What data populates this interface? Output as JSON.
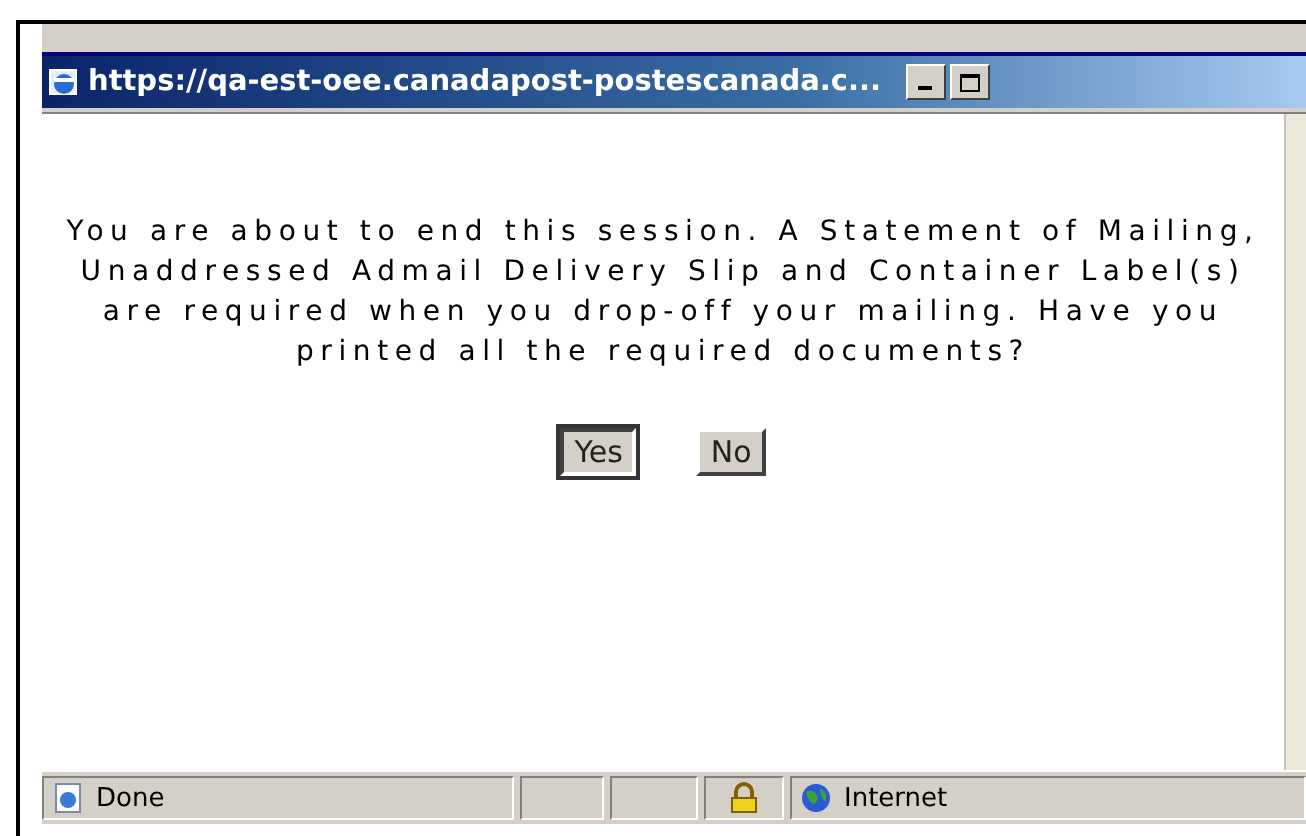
{
  "window": {
    "title": "https://qa-est-oee.canadapost-postescanada.c..."
  },
  "message": "You are about to end this session. A Statement of Mailing, Unaddressed Admail Delivery Slip and Container Label(s) are required when you drop-off your mailing. Have you printed all the required documents?",
  "buttons": [
    {
      "label": "Yes",
      "focused": true
    },
    {
      "label": "No",
      "focused": false
    }
  ],
  "status_bar": {
    "status": "Done",
    "secure": true,
    "zone": "Internet"
  }
}
